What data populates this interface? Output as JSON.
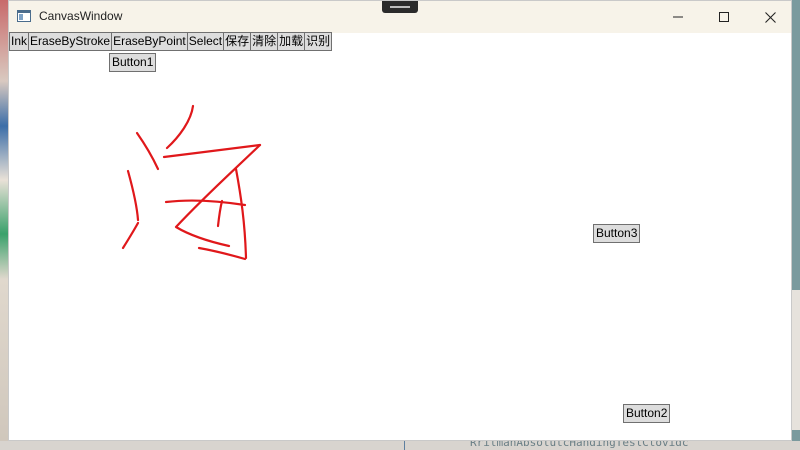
{
  "window": {
    "title": "CanvasWindow",
    "icon": "window-app-icon"
  },
  "toolbar": {
    "buttons": [
      {
        "label": "Ink"
      },
      {
        "label": "EraseByStroke"
      },
      {
        "label": "EraseByPoint"
      },
      {
        "label": "Select"
      },
      {
        "label": "保存"
      },
      {
        "label": "清除"
      },
      {
        "label": "加载"
      },
      {
        "label": "识别"
      }
    ]
  },
  "canvas": {
    "buttons": {
      "button1": "Button1",
      "button2": "Button2",
      "button3": "Button3"
    },
    "ink_color": "#e0181b"
  },
  "desktop": {
    "background_snippet": "RrilmanAbsolutcHandingTeslCtovidc"
  }
}
